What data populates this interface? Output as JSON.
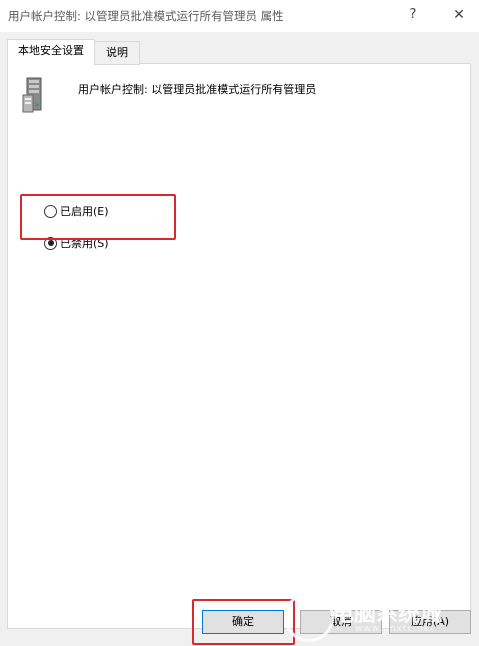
{
  "window": {
    "title": "用户帐户控制: 以管理员批准模式运行所有管理员 属性",
    "help": "?",
    "close": "✕"
  },
  "tabs": [
    {
      "label": "本地安全设置",
      "active": true
    },
    {
      "label": "说明",
      "active": false
    }
  ],
  "policy": {
    "name": "用户帐户控制: 以管理员批准模式运行所有管理员",
    "icon": "server-icon"
  },
  "options": [
    {
      "label": "已启用(E)",
      "checked": false
    },
    {
      "label": "已禁用(S)",
      "checked": true
    }
  ],
  "buttons": {
    "ok": "确定",
    "cancel": "取消",
    "apply": "应用(A)"
  },
  "colors": {
    "highlight": "#d9282f",
    "dialog_bg": "#f0f0f0",
    "default_border": "#0078d7"
  },
  "watermark": {
    "text": "电脑系统城",
    "url": "www.dnxtc.net"
  }
}
